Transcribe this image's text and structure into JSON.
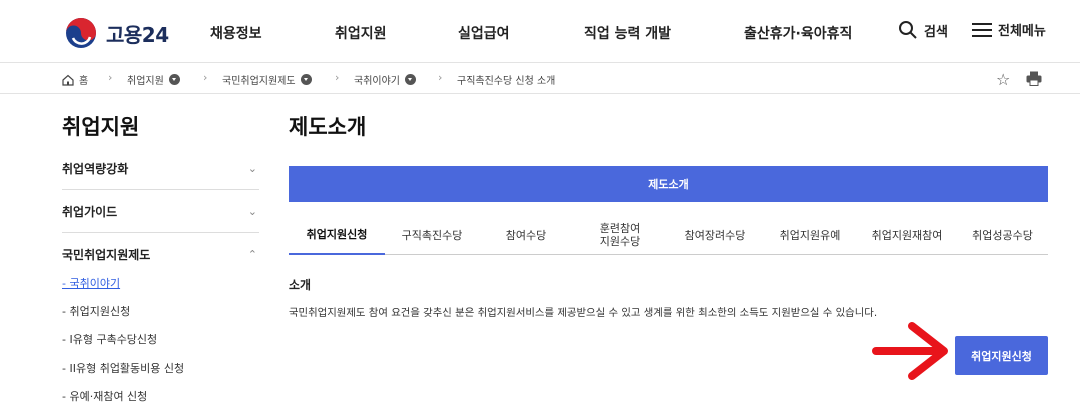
{
  "header": {
    "logo_text": "고용24",
    "nav": [
      "채용정보",
      "취업지원",
      "실업급여",
      "직업 능력 개발",
      "출산휴가·육아휴직"
    ],
    "search_label": "검색",
    "menu_label": "전체메뉴"
  },
  "breadcrumb": {
    "home": "홈",
    "items": [
      "취업지원",
      "국민취업지원제도",
      "국취이야기",
      "구직촉진수당 신청 소개"
    ]
  },
  "sidebar": {
    "title": "취업지원",
    "sections": [
      "취업역량강화",
      "취업가이드",
      "국민취업지원제도"
    ],
    "sub_items": [
      "국취이야기",
      "취업지원신청",
      "I유형 구촉수당신청",
      "II유형 취업활동비용 신청",
      "유예·재참여 신청"
    ]
  },
  "main": {
    "page_title": "제도소개",
    "banner": "제도소개",
    "tabs": [
      "취업지원신청",
      "구직촉진수당",
      "참여수당",
      "훈련참여\n지원수당",
      "참여장려수당",
      "취업지원유예",
      "취업지원재참여",
      "취업성공수당"
    ],
    "active_tab": 0,
    "intro_heading": "소개",
    "intro_text": "국민취업지원제도 참여 요건을 갖추신 분은 취업지원서비스를 제공받으실 수 있고 생계를 위한 최소한의 소득도 지원받으실 수 있습니다.",
    "apply_button": "취업지원신청"
  },
  "colors": {
    "accent": "#4a68dc",
    "annotation_arrow": "#e8141b"
  }
}
